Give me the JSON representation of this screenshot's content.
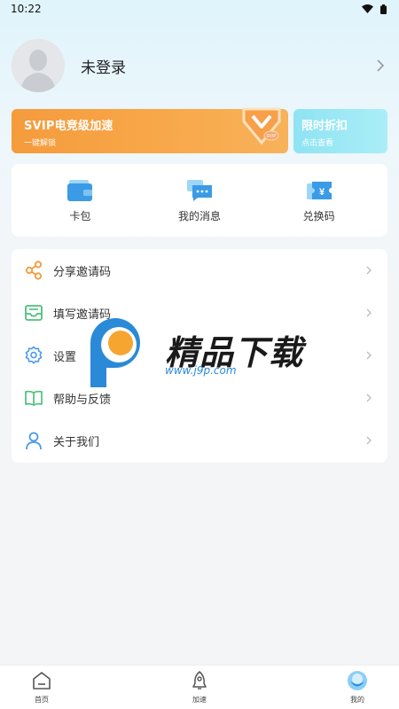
{
  "status_bar": {
    "time": "10:22",
    "icons": [
      "wifi-icon",
      "battery-icon"
    ]
  },
  "profile": {
    "name": "未登录",
    "avatar": "default-avatar"
  },
  "svip": {
    "title": "SVIP电竞级加速",
    "subtitle": "一键解锁",
    "badge": "SVIP"
  },
  "discount": {
    "title": "限时折扣",
    "subtitle": "点击查看"
  },
  "quick_actions": [
    {
      "label": "卡包",
      "icon": "wallet-icon"
    },
    {
      "label": "我的消息",
      "icon": "message-icon"
    },
    {
      "label": "兑换码",
      "icon": "ticket-icon"
    }
  ],
  "menu": [
    {
      "label": "分享邀请码",
      "icon": "share-icon"
    },
    {
      "label": "填写邀请码",
      "icon": "inbox-icon"
    },
    {
      "label": "设置",
      "icon": "gear-icon"
    },
    {
      "label": "帮助与反馈",
      "icon": "book-icon"
    },
    {
      "label": "关于我们",
      "icon": "user-icon"
    }
  ],
  "watermark": {
    "title": "精品下载",
    "url": "www.j9p.com"
  },
  "tabs": [
    {
      "label": "首页",
      "icon": "home-icon"
    },
    {
      "label": "加速",
      "icon": "rocket-icon"
    },
    {
      "label": "我的",
      "icon": "profile-tab-icon",
      "active": true
    }
  ],
  "colors": {
    "accent_orange": "#f59b3c",
    "accent_cyan": "#8fe3f3",
    "tab_active": "#4aa8ee",
    "menu_icon_orange": "#f39a3a",
    "menu_icon_green": "#4cc07a",
    "menu_icon_blue": "#4a9be8"
  }
}
